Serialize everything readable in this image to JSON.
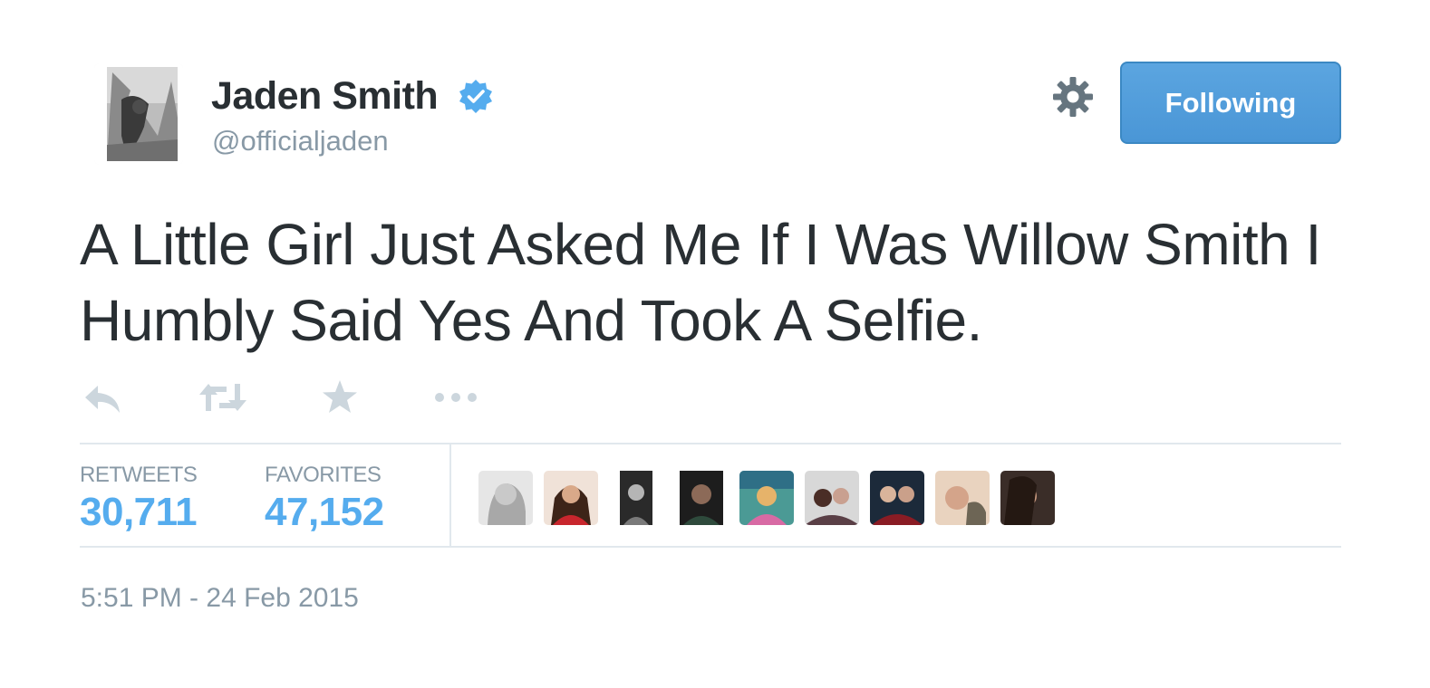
{
  "user": {
    "display_name": "Jaden Smith",
    "handle": "@officialjaden",
    "verified_icon": "verified-badge-icon",
    "avatar_icon": "profile-photo"
  },
  "header": {
    "settings_icon": "gear-icon",
    "follow_button_label": "Following"
  },
  "tweet": {
    "text": "A Little Girl Just Asked Me If I Was Willow Smith I Humbly Said Yes And Took A Selfie."
  },
  "actions": [
    {
      "icon": "reply-icon"
    },
    {
      "icon": "retweet-icon"
    },
    {
      "icon": "favorite-star-icon"
    },
    {
      "icon": "more-dots-icon"
    }
  ],
  "stats": {
    "retweets_label": "RETWEETS",
    "retweets_value": "30,711",
    "favorites_label": "FAVORITES",
    "favorites_value": "47,152"
  },
  "favoriters_count_shown": 9,
  "timestamp": "5:51 PM - 24 Feb 2015",
  "colors": {
    "accent": "#55acee",
    "button_bg": "#4a96d6",
    "muted_text": "#8899a6",
    "body_text": "#292f33",
    "divider": "#e1e8ed",
    "action_icon": "#ccd6dd"
  }
}
